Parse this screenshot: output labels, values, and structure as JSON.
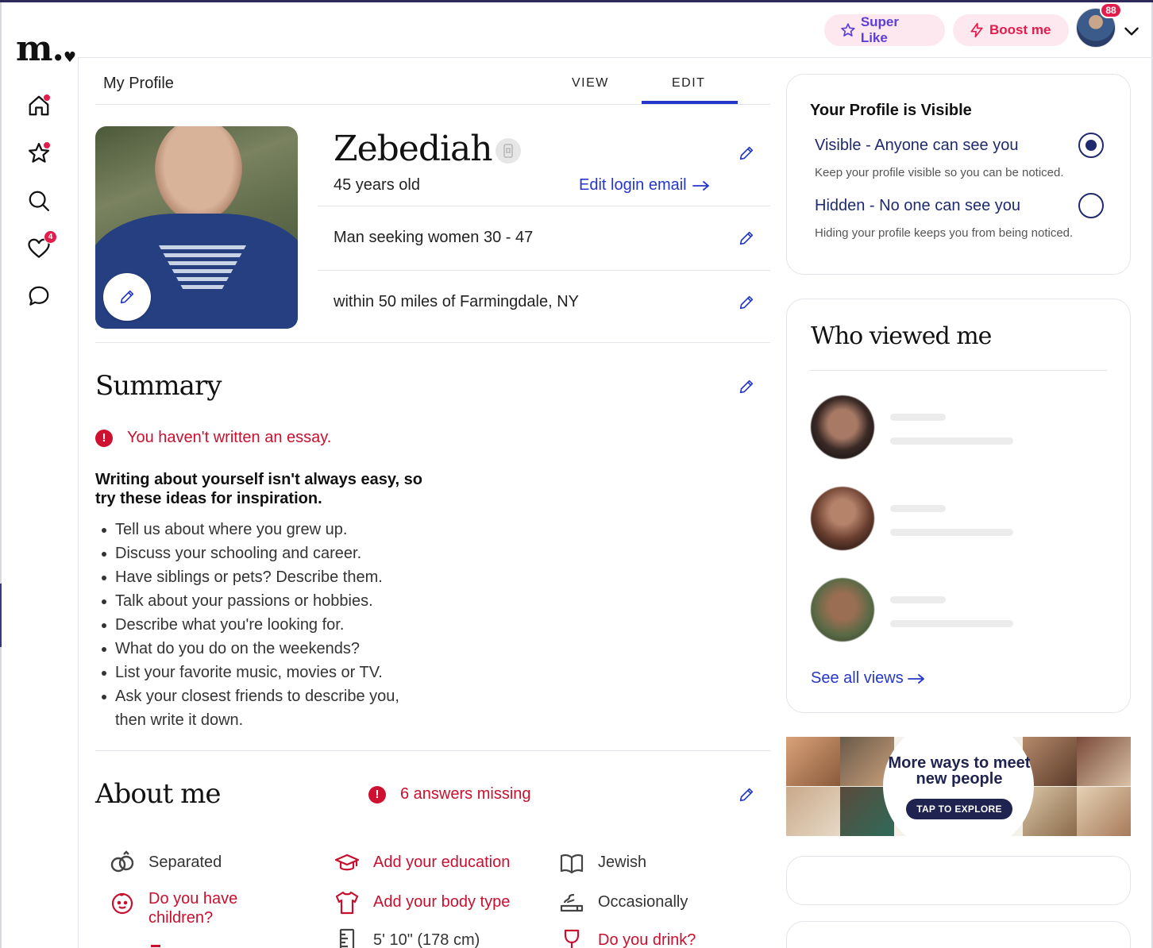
{
  "brand": {
    "logo_text": "m.",
    "logo_heart": "♥"
  },
  "nav": [
    {
      "name": "home-icon",
      "has_dot": true
    },
    {
      "name": "star-icon",
      "has_dot": true
    },
    {
      "name": "search-icon",
      "has_dot": false
    },
    {
      "name": "heart-icon",
      "badge": "4"
    },
    {
      "name": "chat-icon",
      "has_dot": false
    }
  ],
  "topbar": {
    "super_like_label": "Super Like",
    "boost_label": "Boost me",
    "avatar_badge": "88"
  },
  "profile_header": {
    "title": "My Profile",
    "tab_view": "VIEW",
    "tab_edit": "EDIT",
    "active_tab": "EDIT"
  },
  "profile": {
    "name": "Zebediah",
    "age": "45 years old",
    "edit_login_email": "Edit login email",
    "seeking": "Man seeking women 30 - 47",
    "location": "within 50 miles of Farmingdale, NY"
  },
  "summary": {
    "heading": "Summary",
    "alert": "You haven't written an essay.",
    "tips_heading": "Writing about yourself isn't always easy, so try these ideas for inspiration.",
    "tips": [
      "Tell us about where you grew up.",
      "Discuss your schooling and career.",
      "Have siblings or pets? Describe them.",
      "Talk about your passions or hobbies.",
      "Describe what you're looking for.",
      "What do you do on the weekends?",
      "List your favorite music, movies or TV.",
      "Ask your closest friends to describe you, then write it down."
    ]
  },
  "about": {
    "heading": "About me",
    "missing": "6 answers missing",
    "items": [
      {
        "label": "Separated",
        "icon": "rings-icon",
        "missing": false
      },
      {
        "label": "Add your education",
        "icon": "graduation-cap-icon",
        "missing": true
      },
      {
        "label": "Jewish",
        "icon": "book-icon",
        "missing": false
      },
      {
        "label": "Do you have children?",
        "icon": "baby-icon",
        "missing": true
      },
      {
        "label": "Add your body type",
        "icon": "shirt-icon",
        "missing": true
      },
      {
        "label": "Occasionally",
        "icon": "smoke-icon",
        "missing": false
      },
      {
        "label": "5' 10\" (178 cm)",
        "icon": "ruler-icon",
        "missing": false
      },
      {
        "label": "Do you drink?",
        "icon": "wine-icon",
        "missing": true
      }
    ]
  },
  "visibility": {
    "title": "Your Profile is Visible",
    "visible_label": "Visible - Anyone can see you",
    "visible_sub": "Keep your profile visible so you can be noticed.",
    "hidden_label": "Hidden - No one can see you",
    "hidden_sub": "Hiding your profile keeps you from being noticed.",
    "selected": "visible"
  },
  "who_viewed": {
    "heading": "Who viewed me",
    "see_all": "See all views"
  },
  "ad": {
    "headline": "More ways to meet new people",
    "button": "TAP TO EXPLORE"
  },
  "colors": {
    "accent_blue": "#2437c9",
    "alert_red": "#c8102e",
    "badge_red": "#e31c4b",
    "navy": "#1f2a6e"
  }
}
